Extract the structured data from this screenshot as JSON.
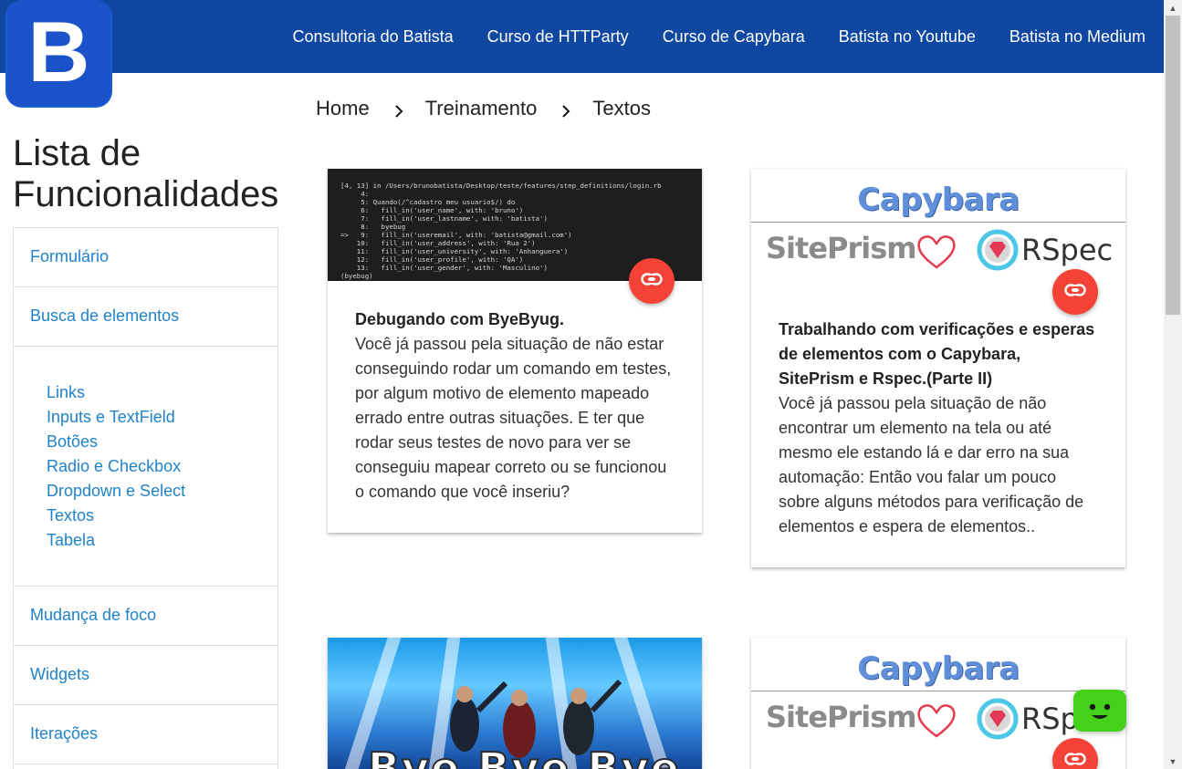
{
  "nav": {
    "logo_letter": "B",
    "links": [
      "Consultoria do Batista",
      "Curso de HTTParty",
      "Curso de Capybara",
      "Batista no Youtube",
      "Batista no Medium"
    ]
  },
  "breadcrumb": [
    "Home",
    "Treinamento",
    "Textos"
  ],
  "sidebar": {
    "title": "Lista de Funcionalidades",
    "items_top": [
      "Formulário",
      "Busca de elementos"
    ],
    "subitems": [
      "Links",
      "Inputs e TextField",
      "Botões",
      "Radio e Checkbox",
      "Dropdown e Select",
      "Textos",
      "Tabela"
    ],
    "items_bottom": [
      "Mudança de foco",
      "Widgets",
      "Iterações"
    ]
  },
  "cards": [
    {
      "title": "Debugando com ByeByug.",
      "text": "Você já passou pela situação de não estar conseguindo rodar um comando em testes, por algum motivo de elemento mapeado errado entre outras situações. E ter que rodar seus testes de novo para ver se conseguiu mapear correto ou se funcionou o comando que você inseriu?",
      "terminal": "[4, 13] in /Users/brunobatista/Desktop/teste/features/step_definitions/login.rb\n     4: \n     5: Quando(/^cadastro meu usuario$/) do\n     6:   fill_in('user_name', with: 'bruno')\n     7:   fill_in('user_lastname', with: 'batista')\n     8:   byebug\n=>   9:   fill_in('useremail', with: 'batista@gmail.com')\n    10:   fill_in('user_address', with: 'Rua 2')\n    11:   fill_in('user_university', with: 'Anhanguera')\n    12:   fill_in('user_profile', with: 'QA')\n    13:   fill_in('user_gender', with: 'Masculino')\n(byebug) "
    },
    {
      "title": "Trabalhando com verificações e esperas de elementos com o Capybara, SitePrism e Rspec.(Parte II)",
      "text": "Você já passou pela situação de não encontrar um elemento na tela ou até mesmo ele estando lá e dar erro na sua automação: Então vou falar um pouco sobre alguns métodos para verificação de elementos e espera de elementos.."
    }
  ],
  "image_labels": {
    "capybara": "Capybara",
    "siteprism": "SitePrism",
    "rspec": "RSpec",
    "bye": "Bye  Bye  Bye"
  },
  "colors": {
    "nav_bg": "#0f47a1",
    "link": "#2083c8",
    "fab": "#f44336",
    "chatbot": "#45d11a"
  },
  "icons": {
    "fab": "link-icon",
    "breadcrumb_sep": "chevron-right-icon",
    "chatbot": "smiley-icon"
  }
}
